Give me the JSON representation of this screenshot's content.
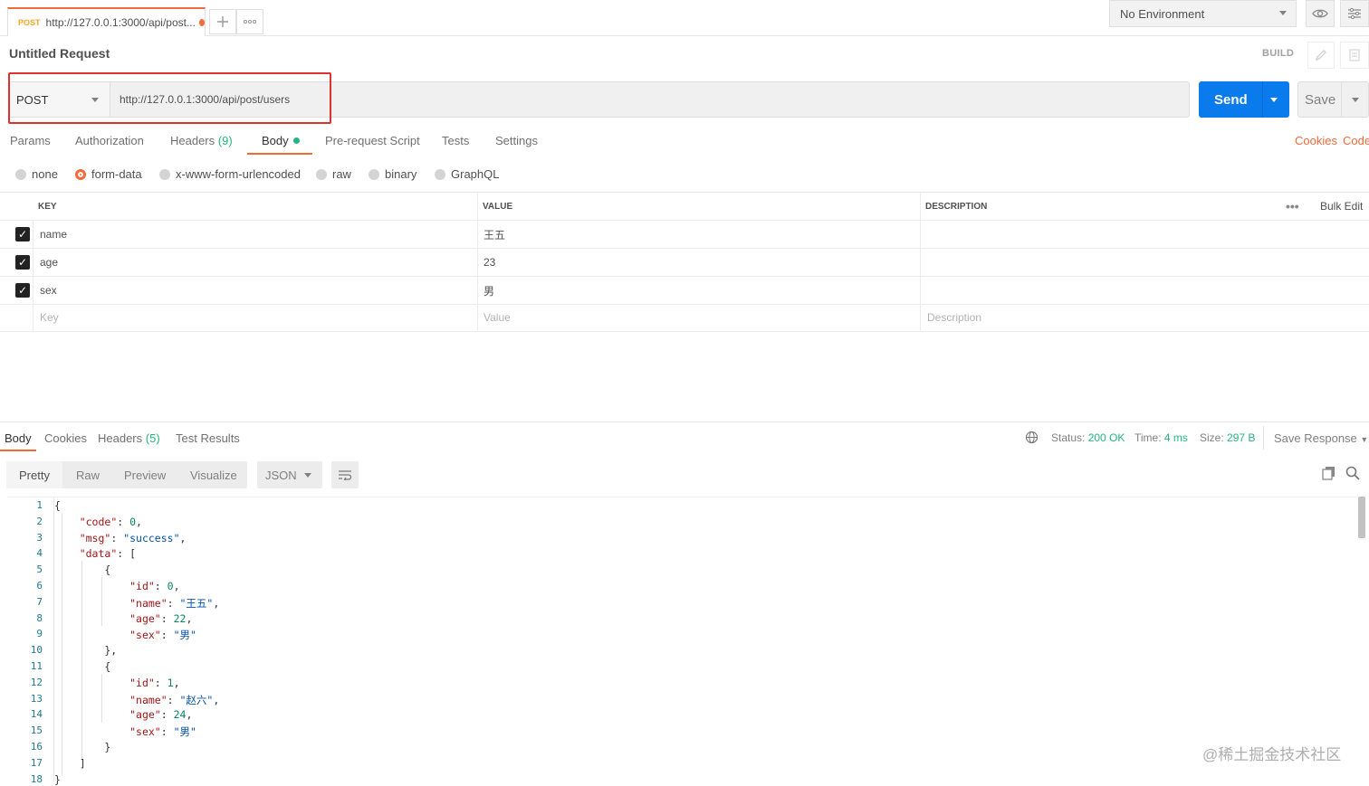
{
  "tab": {
    "method": "POST",
    "title": "http://127.0.0.1:3000/api/post..."
  },
  "tabbar": {
    "new_tab_icon": "plus-icon",
    "more_icon": "ellipsis-icon"
  },
  "environment": {
    "selected": "No Environment"
  },
  "request": {
    "title": "Untitled Request",
    "build_label": "BUILD",
    "method": "POST",
    "url": "http://127.0.0.1:3000/api/post/users",
    "send_label": "Send",
    "save_label": "Save"
  },
  "request_tabs": [
    {
      "label": "Params"
    },
    {
      "label": "Authorization"
    },
    {
      "label": "Headers",
      "count": "(9)"
    },
    {
      "label": "Body"
    },
    {
      "label": "Pre-request Script"
    },
    {
      "label": "Tests"
    },
    {
      "label": "Settings"
    }
  ],
  "request_links": {
    "cookies": "Cookies",
    "code": "Code"
  },
  "body_types": [
    "none",
    "form-data",
    "x-www-form-urlencoded",
    "raw",
    "binary",
    "GraphQL"
  ],
  "body_type_selected": "form-data",
  "form": {
    "headers": {
      "key": "KEY",
      "value": "VALUE",
      "description": "DESCRIPTION",
      "bulk_edit": "Bulk Edit"
    },
    "rows": [
      {
        "checked": true,
        "key": "name",
        "value": "王五"
      },
      {
        "checked": true,
        "key": "age",
        "value": "23"
      },
      {
        "checked": true,
        "key": "sex",
        "value": "男"
      }
    ],
    "placeholders": {
      "key": "Key",
      "value": "Value",
      "description": "Description"
    }
  },
  "response": {
    "tabs": [
      {
        "label": "Body"
      },
      {
        "label": "Cookies"
      },
      {
        "label": "Headers",
        "count": "(5)"
      },
      {
        "label": "Test Results"
      }
    ],
    "status_label": "Status:",
    "status": "200 OK",
    "time_label": "Time:",
    "time": "4 ms",
    "size_label": "Size:",
    "size": "297 B",
    "save_response": "Save Response",
    "view_modes": [
      "Pretty",
      "Raw",
      "Preview",
      "Visualize"
    ],
    "format": "JSON"
  },
  "code_lines": [
    {
      "n": "1",
      "t": "{"
    },
    {
      "n": "2",
      "t": "    \"code\": 0,"
    },
    {
      "n": "3",
      "t": "    \"msg\": \"success\","
    },
    {
      "n": "4",
      "t": "    \"data\": ["
    },
    {
      "n": "5",
      "t": "        {"
    },
    {
      "n": "6",
      "t": "            \"id\": 0,"
    },
    {
      "n": "7",
      "t": "            \"name\": \"王五\","
    },
    {
      "n": "8",
      "t": "            \"age\": 22,"
    },
    {
      "n": "9",
      "t": "            \"sex\": \"男\""
    },
    {
      "n": "10",
      "t": "        },"
    },
    {
      "n": "11",
      "t": "        {"
    },
    {
      "n": "12",
      "t": "            \"id\": 1,"
    },
    {
      "n": "13",
      "t": "            \"name\": \"赵六\","
    },
    {
      "n": "14",
      "t": "            \"age\": 24,"
    },
    {
      "n": "15",
      "t": "            \"sex\": \"男\""
    },
    {
      "n": "16",
      "t": "        }"
    },
    {
      "n": "17",
      "t": "    ]"
    },
    {
      "n": "18",
      "t": "}"
    }
  ],
  "watermark": "@稀土掘金技术社区",
  "colors": {
    "accent": "#f26b3a",
    "send": "#097bed",
    "success": "#26b47f",
    "highlight": "#e03131"
  }
}
